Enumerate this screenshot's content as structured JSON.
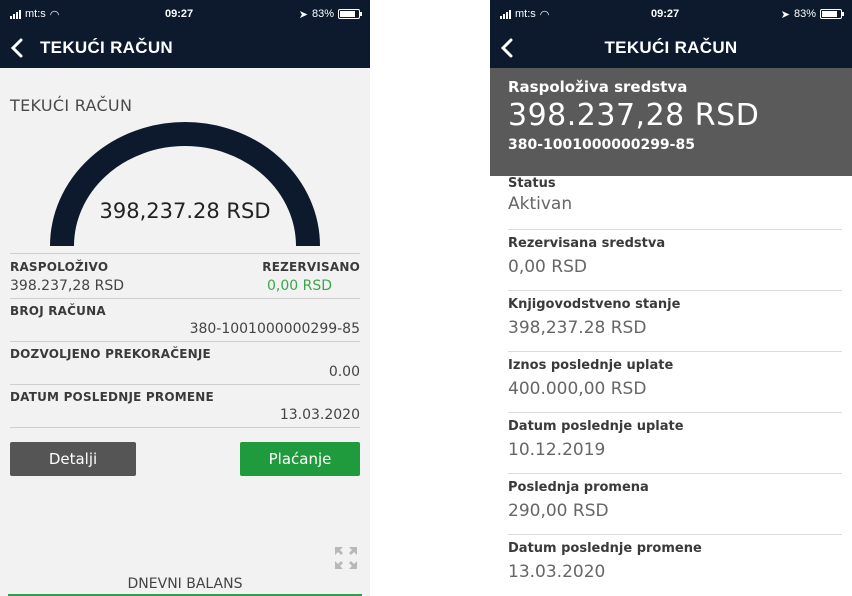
{
  "left": {
    "status": {
      "carrier": "mt:s",
      "time": "09:27",
      "battery": "83%"
    },
    "nav_title": "TEKUĆI RAČUN",
    "card_title": "TEKUĆI RAČUN",
    "gauge_value": "398,237.28 RSD",
    "available_label": "RASPOLOŽIVO",
    "available_value": "398.237,28 RSD",
    "reserved_label": "REZERVISANO",
    "reserved_value": "0,00 RSD",
    "account_label": "BROJ RAČUNA",
    "account_value": "380-1001000000299-85",
    "overdraft_label": "DOZVOLJENO PREKORAČENJE",
    "overdraft_value": "0.00",
    "last_change_label": "DATUM POSLEDNJE PROMENE",
    "last_change_value": "13.03.2020",
    "details_button": "Detalji",
    "payment_button": "Plaćanje",
    "daily_balance": "DNEVNI BALANS"
  },
  "right": {
    "status": {
      "carrier": "mt:s",
      "time": "09:27",
      "battery": "83%"
    },
    "nav_title": "TEKUĆI RAČUN",
    "summary": {
      "label": "Raspoloživa sredstva",
      "amount": "398.237,28 RSD",
      "account": "380-1001000000299-85"
    },
    "details": [
      {
        "label": "Status",
        "value": "Aktivan"
      },
      {
        "label": "Rezervisana sredstva",
        "value": "0,00 RSD"
      },
      {
        "label": "Knjigovodstveno stanje",
        "value": "398,237.28 RSD"
      },
      {
        "label": "Iznos poslednje uplate",
        "value": "400.000,00 RSD"
      },
      {
        "label": "Datum poslednje uplate",
        "value": "10.12.2019"
      },
      {
        "label": "Poslednja promena",
        "value": "290,00 RSD"
      },
      {
        "label": "Datum poslednje promene",
        "value": "13.03.2020"
      }
    ]
  },
  "colors": {
    "header": "#0d1a2e",
    "gauge": "#0d1a2e",
    "accent_green": "#1f9a3c",
    "summary_bg": "#5a5a5a"
  },
  "icons": [
    "signal-icon",
    "wifi-icon",
    "location-icon",
    "battery-icon",
    "back-chevron-icon",
    "expand-icon"
  ]
}
